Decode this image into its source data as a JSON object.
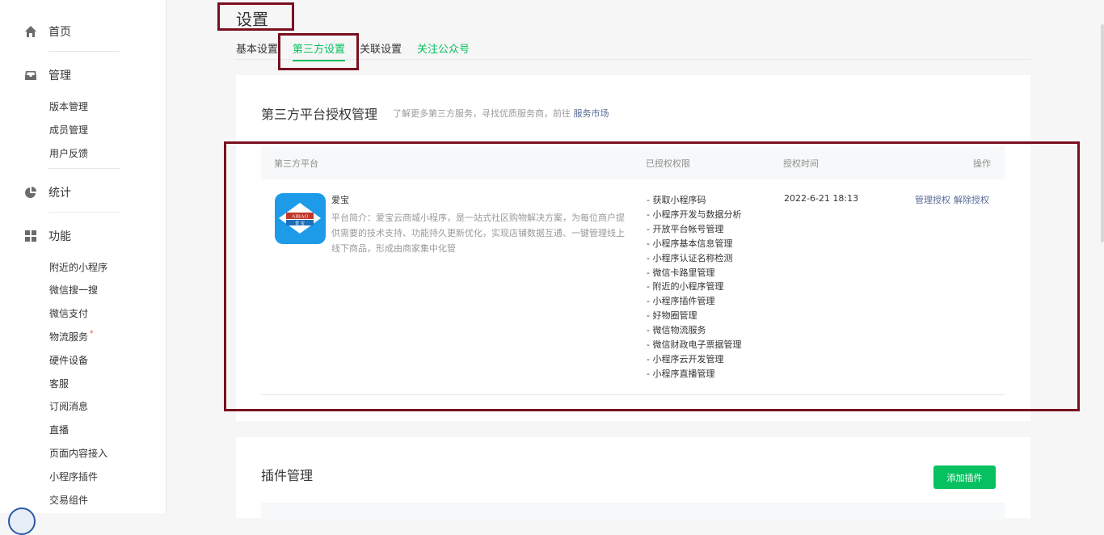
{
  "sidebar": {
    "home": {
      "label": "首页",
      "icon": "home-icon"
    },
    "manage": {
      "label": "管理",
      "icon": "inbox-icon",
      "items": [
        "版本管理",
        "成员管理",
        "用户反馈"
      ]
    },
    "stats": {
      "label": "统计",
      "icon": "pie-chart-icon"
    },
    "features": {
      "label": "功能",
      "icon": "grid-icon",
      "items": [
        "附近的小程序",
        "微信搜一搜",
        "微信支付",
        "物流服务",
        "硬件设备",
        "客服",
        "订阅消息",
        "直播",
        "页面内容接入",
        "小程序插件",
        "交易组件"
      ],
      "badge_marker": "*"
    }
  },
  "page": {
    "title": "设置"
  },
  "tabs": [
    "基本设置",
    "第三方设置",
    "关联设置",
    "关注公众号"
  ],
  "third_party": {
    "title": "第三方平台授权管理",
    "subtitle": "了解更多第三方服务，寻找优质服务商，前往",
    "subtitle_link": "服务市场",
    "columns": [
      "第三方平台",
      "已授权权限",
      "授权时间",
      "操作"
    ],
    "row": {
      "name": "爱宝",
      "logo_text": "AIBAO",
      "logo_sub": "爱 宝",
      "desc": "平台简介：爱宝云商城小程序，是一站式社区购物解决方案，为每位商户提供需要的技术支持、功能持久更新优化，实现店铺数据互通、一键管理线上线下商品，形成由商家集中化管",
      "permissions": [
        "- 获取小程序码",
        "- 小程序开发与数据分析",
        "- 开放平台帐号管理",
        "- 小程序基本信息管理",
        "- 小程序认证名称检测",
        "- 微信卡路里管理",
        "- 附近的小程序管理",
        "- 小程序插件管理",
        "- 好物圈管理",
        "- 微信物流服务",
        "- 微信财政电子票据管理",
        "- 小程序云开发管理",
        "- 小程序直播管理"
      ],
      "time": "2022-6-21 18:13",
      "ops": [
        "管理授权",
        "解除授权"
      ]
    }
  },
  "plugins": {
    "title": "插件管理",
    "add_button": "添加插件"
  },
  "colors": {
    "accent": "#07c160",
    "link": "#576b95",
    "highlight": "#7a0f1f",
    "logo_bg": "#1d9be9"
  }
}
